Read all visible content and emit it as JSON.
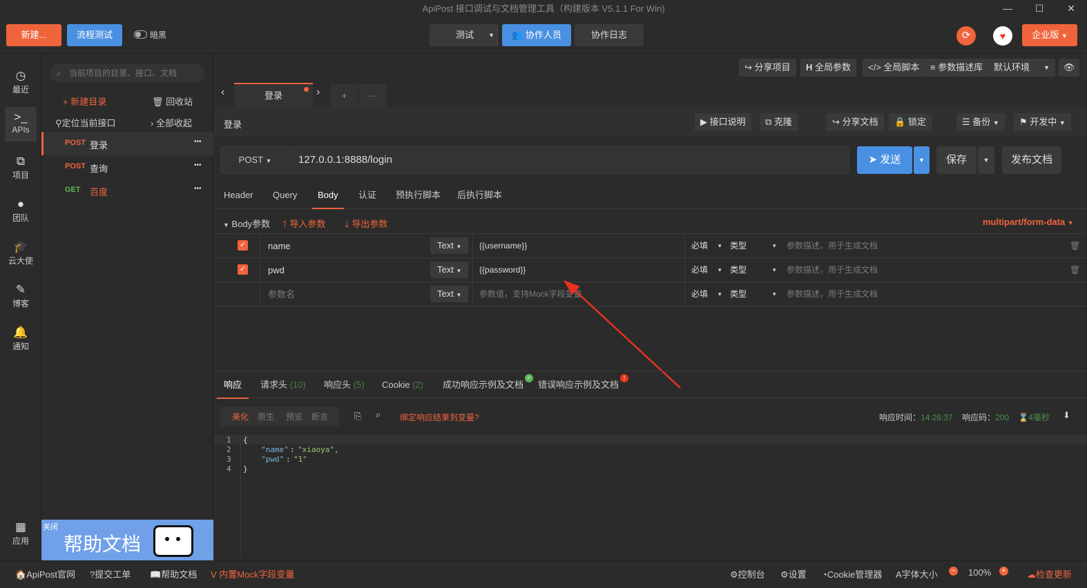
{
  "window": {
    "title": "ApiPost 接口调试与文档管理工具（构建版本 V5.1.1 For Win)",
    "min": "—",
    "max": "☐",
    "close": "✕"
  },
  "toolbar": {
    "new_label": "新建...",
    "flow_label": "流程测试",
    "dark_label": "暗黑",
    "test_label": "测试",
    "collab_label": "协作人员",
    "log_label": "协作日志",
    "enterprise_label": "企业版"
  },
  "nav": [
    {
      "label": "最近",
      "icon": "clock-icon"
    },
    {
      "label": "APIs",
      "icon": "terminal-icon"
    },
    {
      "label": "项目",
      "icon": "project-icon"
    },
    {
      "label": "团队",
      "icon": "team-icon"
    },
    {
      "label": "云大使",
      "icon": "graduation-icon"
    },
    {
      "label": "博客",
      "icon": "edit-icon"
    },
    {
      "label": "通知",
      "icon": "bell-icon"
    },
    {
      "label": "应用",
      "icon": "grid-icon"
    }
  ],
  "sidebar": {
    "search_placeholder": "当前项目的目录、接口、文档",
    "new_dir": "+ 新建目录",
    "recycle": "回收站",
    "locate": "定位当前接口",
    "collapse": "全部收起",
    "apis": [
      {
        "method": "POST",
        "name": "登录",
        "more": "•••"
      },
      {
        "method": "POST",
        "name": "查询",
        "more": "•••"
      },
      {
        "method": "GET",
        "name": "百度",
        "more": "•••"
      }
    ],
    "help_close": "关闭",
    "help_text": "帮助文档"
  },
  "header_actions": {
    "share_project": "分享项目",
    "global_params": "全局参数",
    "global_script": "全局脚本",
    "param_lib": "参数描述库",
    "env": "默认环境"
  },
  "tabs": {
    "active": "登录",
    "add": "+",
    "more": "···"
  },
  "request": {
    "name": "登录",
    "actions": {
      "doc": "接口说明",
      "clone": "克隆",
      "share": "分享文档",
      "lock": "锁定",
      "backup": "备份",
      "status": "开发中"
    },
    "method": "POST",
    "url": "127.0.0.1:8888/login",
    "send": "发送",
    "save": "保存",
    "publish": "发布文档"
  },
  "req_tabs": [
    "Header",
    "Query",
    "Body",
    "认证",
    "预执行脚本",
    "后执行脚本"
  ],
  "body": {
    "label": "Body参数",
    "import": "导入参数",
    "export": "导出参数",
    "content_type": "multipart/form-data",
    "rows": [
      {
        "checked": "✓",
        "name": "name",
        "type": "Text",
        "value": "{{username}}",
        "required": "必填",
        "kind": "类型",
        "desc": "参数描述，用于生成文档"
      },
      {
        "checked": "✓",
        "name": "pwd",
        "type": "Text",
        "value": "{{password}}",
        "required": "必填",
        "kind": "类型",
        "desc": "参数描述，用于生成文档"
      },
      {
        "checked": "",
        "name": "参数名",
        "type": "Text",
        "value": "参数值，支持Mock字段变量",
        "required": "必填",
        "kind": "类型",
        "desc": "参数描述，用于生成文档"
      }
    ]
  },
  "resp_tabs": {
    "response": "响应",
    "req_headers": "请求头",
    "req_headers_count": "(10)",
    "resp_headers": "响应头",
    "resp_headers_count": "(5)",
    "cookie": "Cookie",
    "cookie_count": "(2)",
    "success_doc": "成功响应示例及文档",
    "error_doc": "错误响应示例及文档"
  },
  "resp_view": {
    "modes": [
      "美化",
      "原生",
      "预览",
      "断言"
    ],
    "bind": "绑定响应结果到变量?",
    "time_label": "响应时间：",
    "time": "14:26:37",
    "code_label": "响应码：",
    "code": "200",
    "duration": "4毫秒"
  },
  "code_lines": [
    {
      "n": "1",
      "text": "{"
    },
    {
      "n": "2",
      "key": "\"name\"",
      "val": "\"xiaoya\","
    },
    {
      "n": "3",
      "key": "\"pwd\"",
      "val": "\"1\""
    },
    {
      "n": "4",
      "text": "}"
    }
  ],
  "status": {
    "site": "ApiPost官网",
    "ticket": "提交工单",
    "help": "帮助文档",
    "mock": "内置Mock字段变量",
    "console": "控制台",
    "settings": "设置",
    "cookie": "Cookie管理器",
    "font": "字体大小",
    "zoom": "100%",
    "update": "检查更新"
  },
  "colors": {
    "accent": "#f0643c",
    "blue": "#4a90e2",
    "bg": "#2b2b2b"
  }
}
